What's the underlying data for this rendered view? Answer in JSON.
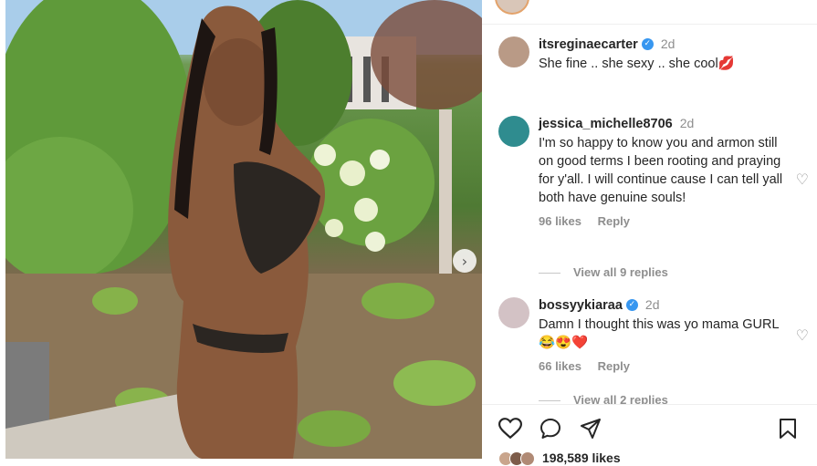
{
  "post": {
    "next_arrow": "›"
  },
  "comments": [
    {
      "username": "itsreginaecarter",
      "verified": true,
      "time": "2d",
      "text": "She fine .. she sexy .. she cool💋"
    },
    {
      "username": "jessica_michelle8706",
      "verified": false,
      "time": "2d",
      "text": "I'm so happy to know you and armon still on good terms I been rooting and praying for y'all. I will continue cause I can tell yall both have genuine souls!",
      "likes": "96 likes",
      "reply": "Reply",
      "view_replies": "View all 9 replies"
    },
    {
      "username": "bossyykiaraa",
      "verified": true,
      "time": "2d",
      "text": "Damn I thought this was yo mama GURL 😂😍❤️",
      "likes": "66 likes",
      "reply": "Reply",
      "view_replies": "View all 2 replies"
    }
  ],
  "footer": {
    "likes_count": "198,589 likes"
  },
  "icons": {
    "like": "heart-icon",
    "comment": "comment-icon",
    "share": "share-icon",
    "save": "bookmark-icon"
  },
  "colors": {
    "verified": "#3897f0",
    "meta_gray": "#8e8e8e"
  }
}
